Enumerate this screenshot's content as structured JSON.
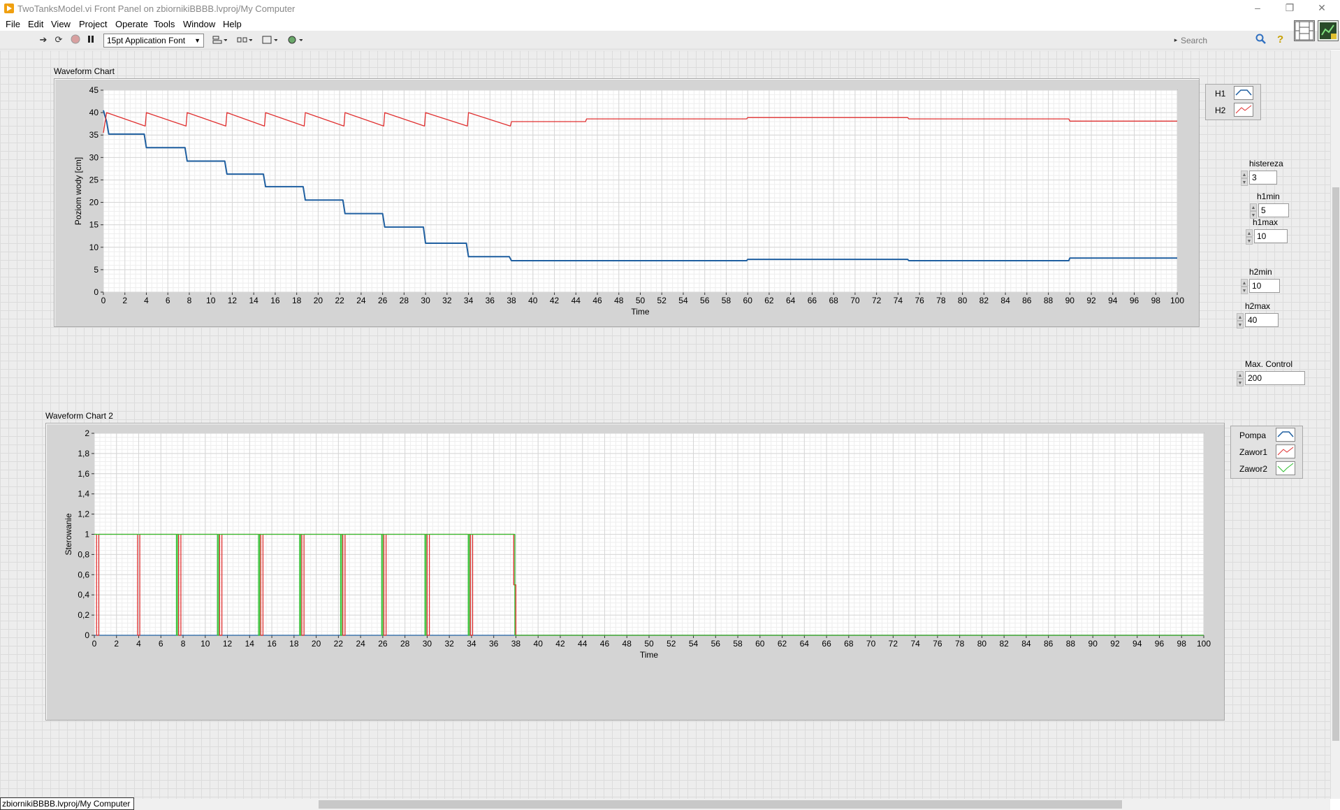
{
  "window": {
    "title": "TwoTanksModel.vi Front Panel on zbiornikiBBBB.lvproj/My Computer",
    "controls": {
      "minimize": "–",
      "restore": "❐",
      "close": "✕"
    }
  },
  "menu": [
    "File",
    "Edit",
    "View",
    "Project",
    "Operate",
    "Tools",
    "Window",
    "Help"
  ],
  "toolbar": {
    "font": "15pt Application Font",
    "search_placeholder": "Search",
    "help": "?"
  },
  "status_bar": "zbiornikiBBBB.lvproj/My Computer",
  "chart1": {
    "label": "Waveform Chart",
    "legend": [
      {
        "name": "H1",
        "color": "#1f5fa0"
      },
      {
        "name": "H2",
        "color": "#e03030"
      }
    ]
  },
  "chart2": {
    "label": "Waveform Chart 2",
    "legend": [
      {
        "name": "Pompa",
        "color": "#1f5fa0"
      },
      {
        "name": "Zawor1",
        "color": "#e03030"
      },
      {
        "name": "Zawor2",
        "color": "#30c030"
      }
    ]
  },
  "controls": {
    "histereza": {
      "label": "histereza",
      "value": "3"
    },
    "h1min": {
      "label": "h1min",
      "value": "5"
    },
    "h1max": {
      "label": "h1max",
      "value": "10"
    },
    "h2min": {
      "label": "h2min",
      "value": "10"
    },
    "h2max": {
      "label": "h2max",
      "value": "40"
    },
    "max_control": {
      "label": "Max. Control",
      "value": "200"
    }
  },
  "chart_data": [
    {
      "type": "line",
      "title": "Waveform Chart",
      "xlabel": "Time",
      "ylabel": "Poziom wody [cm]",
      "xlim": [
        0,
        100
      ],
      "ylim": [
        0,
        45
      ],
      "x_ticks": [
        0,
        2,
        4,
        6,
        8,
        10,
        12,
        14,
        16,
        18,
        20,
        22,
        24,
        26,
        28,
        30,
        32,
        34,
        36,
        38,
        40,
        42,
        44,
        46,
        48,
        50,
        52,
        54,
        56,
        58,
        60,
        62,
        64,
        66,
        68,
        70,
        72,
        74,
        76,
        78,
        80,
        82,
        84,
        86,
        88,
        90,
        92,
        94,
        96,
        98,
        100
      ],
      "y_ticks": [
        0,
        5,
        10,
        15,
        20,
        25,
        30,
        35,
        40,
        45
      ],
      "grid": true,
      "legend_position": "right",
      "series": [
        {
          "name": "H1",
          "color": "#1f5fa0",
          "x": [
            0,
            0.3,
            0.5,
            3.8,
            4.0,
            7.6,
            7.8,
            11.3,
            11.5,
            14.9,
            15.1,
            18.6,
            18.8,
            22.3,
            22.5,
            26.0,
            26.2,
            29.8,
            30.0,
            33.8,
            34.0,
            37.8,
            38.0,
            59.9,
            60.0,
            74.9,
            75.0,
            89.9,
            90.0,
            100
          ],
          "y": [
            40.5,
            38,
            35.2,
            35.2,
            32.2,
            32.2,
            29.2,
            29.2,
            26.3,
            26.3,
            23.5,
            23.5,
            20.5,
            20.5,
            17.5,
            17.5,
            14.5,
            14.5,
            10.9,
            10.9,
            7.9,
            7.9,
            7.0,
            7.0,
            7.3,
            7.3,
            7.0,
            7.0,
            7.6,
            7.6
          ]
        },
        {
          "name": "H2",
          "color": "#e03030",
          "x": [
            0,
            0.3,
            3.9,
            4.0,
            7.7,
            7.8,
            11.4,
            11.5,
            15.0,
            15.1,
            18.7,
            18.8,
            22.4,
            22.5,
            26.1,
            26.2,
            29.9,
            30.0,
            33.9,
            34.0,
            37.9,
            38.0,
            44.9,
            45.0,
            59.9,
            60.0,
            74.9,
            75.0,
            89.9,
            90.0,
            100
          ],
          "y": [
            35.5,
            40.0,
            37.0,
            40.0,
            37.0,
            40.0,
            37.0,
            40.0,
            37.0,
            40.0,
            37.0,
            40.0,
            37.0,
            40.0,
            37.0,
            40.0,
            37.0,
            40.0,
            37.0,
            40.0,
            37.0,
            38.0,
            38.0,
            38.6,
            38.6,
            38.9,
            38.9,
            38.6,
            38.6,
            38.1,
            38.1
          ]
        }
      ]
    },
    {
      "type": "line",
      "title": "Waveform Chart 2",
      "xlabel": "Time",
      "ylabel": "Sterowanie",
      "xlim": [
        0,
        100
      ],
      "ylim": [
        0,
        2
      ],
      "x_ticks": [
        0,
        2,
        4,
        6,
        8,
        10,
        12,
        14,
        16,
        18,
        20,
        22,
        24,
        26,
        28,
        30,
        32,
        34,
        36,
        38,
        40,
        42,
        44,
        46,
        48,
        50,
        52,
        54,
        56,
        58,
        60,
        62,
        64,
        66,
        68,
        70,
        72,
        74,
        76,
        78,
        80,
        82,
        84,
        86,
        88,
        90,
        92,
        94,
        96,
        98,
        100
      ],
      "y_ticks": [
        "0",
        "0,2",
        "0,4",
        "0,6",
        "0,8",
        "1",
        "1,2",
        "1,4",
        "1,6",
        "1,8",
        "2"
      ],
      "grid": true,
      "legend_position": "right",
      "series": [
        {
          "name": "Pompa",
          "color": "#1f5fa0",
          "x": [
            0,
            100
          ],
          "y": [
            0,
            0
          ]
        },
        {
          "name": "Zawor1",
          "color": "#e03030",
          "x": [
            0,
            0.2,
            0.2,
            0.4,
            0.4,
            3.9,
            3.9,
            4.1,
            4.1,
            7.6,
            7.6,
            7.8,
            7.8,
            11.3,
            11.3,
            11.5,
            11.5,
            15.0,
            15.0,
            15.2,
            15.2,
            18.7,
            18.7,
            18.9,
            18.9,
            22.4,
            22.4,
            22.6,
            22.6,
            26.1,
            26.1,
            26.3,
            26.3,
            30.0,
            30.0,
            30.2,
            30.2,
            33.9,
            33.9,
            34.1,
            34.1,
            37.8,
            37.8,
            38.0,
            38.0,
            100
          ],
          "y": [
            1,
            1,
            0,
            0,
            1,
            1,
            0,
            0,
            1,
            1,
            0,
            0,
            1,
            1,
            0,
            0,
            1,
            1,
            0,
            0,
            1,
            1,
            0,
            0,
            1,
            1,
            0,
            0,
            1,
            1,
            0,
            0,
            1,
            1,
            0,
            0,
            1,
            1,
            0,
            0,
            1,
            1,
            0.5,
            0.5,
            0,
            0
          ]
        },
        {
          "name": "Zawor2",
          "color": "#30c030",
          "x": [
            0,
            7.4,
            7.4,
            7.5,
            7.5,
            11.1,
            11.1,
            11.2,
            11.2,
            14.8,
            14.8,
            14.9,
            14.9,
            18.5,
            18.5,
            18.6,
            18.6,
            22.2,
            22.2,
            22.3,
            22.3,
            25.9,
            25.9,
            26.0,
            26.0,
            29.8,
            29.8,
            29.9,
            29.9,
            33.7,
            33.7,
            33.8,
            33.8,
            37.9,
            37.9,
            100
          ],
          "y": [
            1,
            1,
            0,
            0,
            1,
            1,
            0,
            0,
            1,
            1,
            0,
            0,
            1,
            1,
            0,
            0,
            1,
            1,
            0,
            0,
            1,
            1,
            0,
            0,
            1,
            1,
            0,
            0,
            1,
            1,
            0,
            0,
            1,
            1,
            0,
            0
          ]
        }
      ]
    }
  ]
}
